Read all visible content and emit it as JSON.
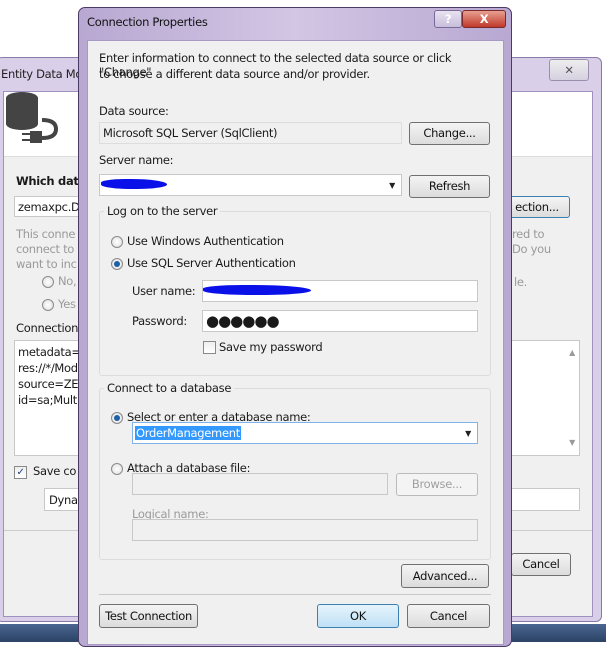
{
  "back_window": {
    "title": "Entity Data Mo",
    "close_glyph": "✕",
    "which_data_label": "Which data",
    "connection_combo": "zemaxpc.D",
    "new_connection_button": "ection...",
    "info_lines": [
      "This conne",
      "connect to",
      "want to inc"
    ],
    "info_lines_right": [
      "red to",
      "Do you",
      "le."
    ],
    "radio_no": "No,",
    "radio_yes": "Yes",
    "connection_label": "Connection",
    "connection_string_lines": [
      "metadata=",
      "res://*/Mod",
      "source=ZEI",
      "id=sa;Multi"
    ],
    "save_checkbox_label": "Save co",
    "save_checked": true,
    "entity_name_value": "Dyna",
    "cancel_button": "Cancel"
  },
  "dialog": {
    "title": "Connection Properties",
    "help_glyph": "?",
    "close_glyph": "X",
    "intro_line1": "Enter information to connect to the selected data source or click \"Change\"",
    "intro_line2": "to choose a different data source and/or provider.",
    "data_source_label": "Data source:",
    "data_source_value": "Microsoft SQL Server (SqlClient)",
    "change_button": "Change...",
    "server_name_label": "Server name:",
    "refresh_button": "Refresh",
    "logon_group": "Log on to the server",
    "windows_auth": "Use Windows Authentication",
    "sql_auth": "Use SQL Server Authentication",
    "auth_selected": "sql",
    "user_name_label": "User name:",
    "password_label": "Password:",
    "password_value": "●●●●●●",
    "save_password": "Save my password",
    "save_password_checked": false,
    "db_group": "Connect to a database",
    "select_db_radio": "Select or enter a database name:",
    "db_name_value": "OrderManagement",
    "attach_db_radio": "Attach a database file:",
    "browse_button": "Browse...",
    "logical_name_label": "Logical name:",
    "advanced_button": "Advanced...",
    "test_connection_button": "Test Connection",
    "ok_button": "OK",
    "cancel_button": "Cancel",
    "redaction_color": "#0a10e8"
  }
}
